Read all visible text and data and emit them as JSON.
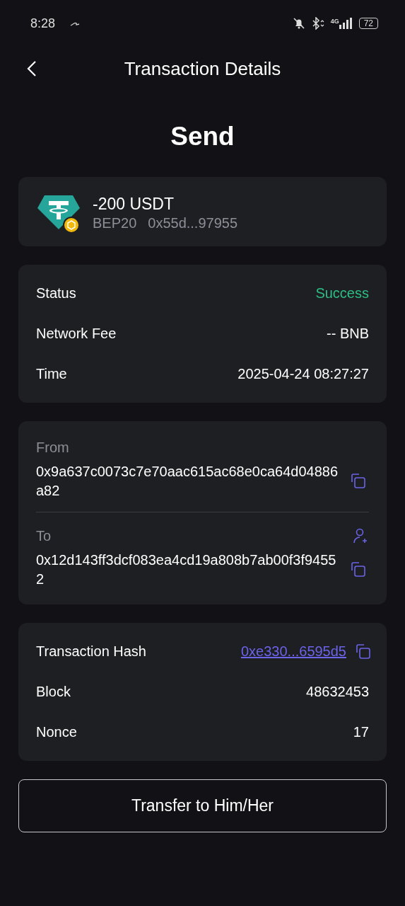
{
  "status_bar": {
    "time": "8:28",
    "battery": "72",
    "network": "4G"
  },
  "header": {
    "title": "Transaction Details"
  },
  "heading": "Send",
  "token": {
    "amount": "-200 USDT",
    "network": "BEP20",
    "address": "0x55d...97955"
  },
  "details": [
    {
      "label": "Status",
      "value": "Success",
      "kind": "status"
    },
    {
      "label": "Network Fee",
      "value": "-- BNB",
      "kind": "plain"
    },
    {
      "label": "Time",
      "value": "2025-04-24 08:27:27",
      "kind": "plain"
    }
  ],
  "parties": [
    {
      "label": "From",
      "address": "0x9a637c0073c7e70aac615ac68e0ca64d04886a82",
      "add_contact": false
    },
    {
      "label": "To",
      "address": "0x12d143ff3dcf083ea4cd19a808b7ab00f3f94552",
      "add_contact": true
    }
  ],
  "chain_info": [
    {
      "label": "Transaction Hash",
      "value": "0xe330...6595d5",
      "kind": "link"
    },
    {
      "label": "Block",
      "value": "48632453",
      "kind": "plain"
    },
    {
      "label": "Nonce",
      "value": "17",
      "kind": "plain"
    }
  ],
  "action_button": "Transfer to Him/Her"
}
